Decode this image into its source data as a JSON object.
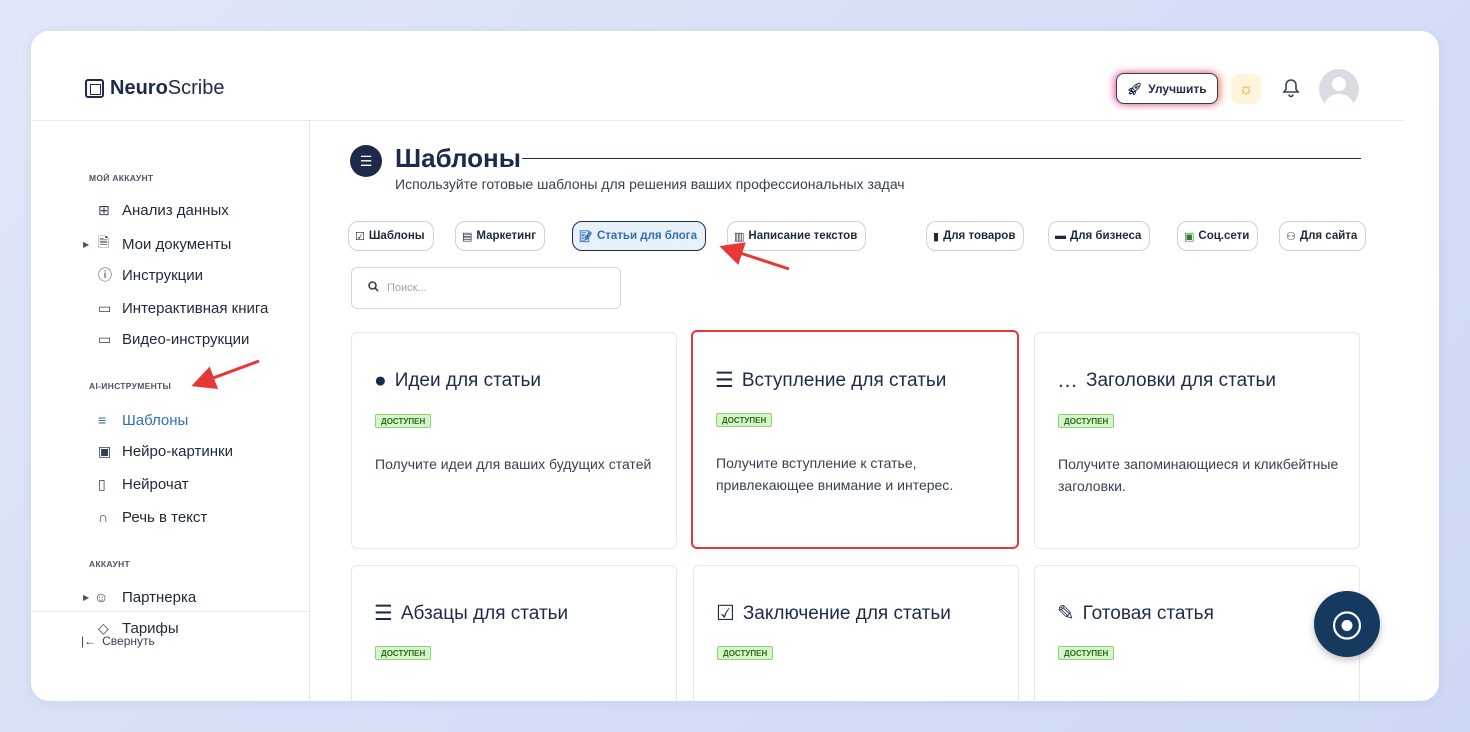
{
  "header": {
    "logo_bold": "Neuro",
    "logo_rest": "Scribe",
    "upgrade_label": "Улучшить"
  },
  "sidebar": {
    "sections": [
      {
        "title": "МОЙ АККАУНТ"
      },
      {
        "title": "AI-ИНСТРУМЕНТЫ"
      },
      {
        "title": "АККАУНТ"
      }
    ],
    "items": [
      {
        "label": "Анализ данных",
        "icon": "grid-icon"
      },
      {
        "label": "Мои документы",
        "icon": "document-icon"
      },
      {
        "label": "Инструкции",
        "icon": "help-circle-icon"
      },
      {
        "label": "Интерактивная книга",
        "icon": "book-icon"
      },
      {
        "label": "Видео-инструкции",
        "icon": "video-icon"
      },
      {
        "label": "Шаблоны",
        "icon": "layers-icon",
        "active": true
      },
      {
        "label": "Нейро-картинки",
        "icon": "image-icon"
      },
      {
        "label": "Нейрочат",
        "icon": "chat-icon"
      },
      {
        "label": "Речь в текст",
        "icon": "headphones-icon"
      },
      {
        "label": "Партнерка",
        "icon": "users-icon"
      },
      {
        "label": "Тарифы",
        "icon": "tag-icon"
      }
    ],
    "collapse_label": "Свернуть"
  },
  "main": {
    "title": "Шаблоны",
    "subtitle": "Используйте готовые шаблоны для решения ваших профессиональных задач",
    "tabs": [
      {
        "label": "Шаблоны"
      },
      {
        "label": "Маркетинг"
      },
      {
        "label": "Статьи для блога",
        "active": true
      },
      {
        "label": "Написание текстов"
      },
      {
        "label": "Для товаров"
      },
      {
        "label": "Для бизнеса"
      },
      {
        "label": "Соц.сети"
      },
      {
        "label": "Для сайта"
      }
    ],
    "search_placeholder": "Поиск...",
    "cards": [
      {
        "title": "Идеи для статьи",
        "badge": "ДОСТУПЕН",
        "desc": "Получите идеи для ваших будущих статей"
      },
      {
        "title": "Вступление для статьи",
        "badge": "ДОСТУПЕН",
        "desc": "Получите вступление к статье, привлекающее внимание и интерес."
      },
      {
        "title": "Заголовки для статьи",
        "badge": "ДОСТУПЕН",
        "desc": "Получите запоминающиеся и кликбейтные заголовки."
      },
      {
        "title": "Абзацы для статьи",
        "badge": "ДОСТУПЕН"
      },
      {
        "title": "Заключение для статьи",
        "badge": "ДОСТУПЕН"
      },
      {
        "title": "Готовая статья",
        "badge": "ДОСТУПЕН"
      }
    ]
  },
  "colors": {
    "accent": "#2f6fb3",
    "navy": "#1e2a4a",
    "highlight_red": "#e53935",
    "badge_green": "#d5f5c8"
  }
}
